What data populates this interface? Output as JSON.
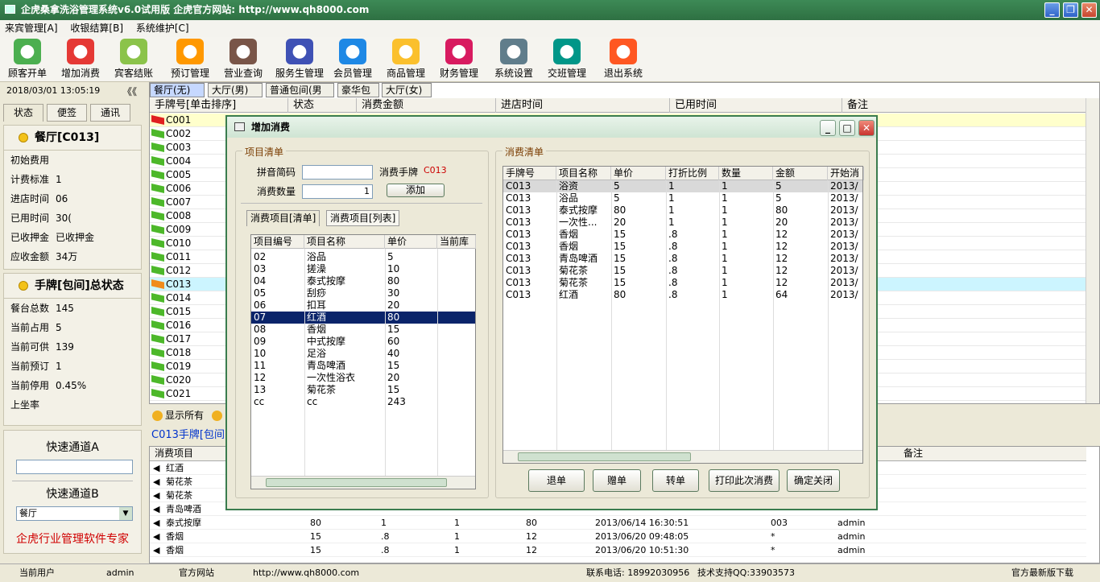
{
  "window": {
    "title": "企虎桑拿洗浴管理系统v6.0试用版    企虎官方网站: http://www.qh8000.com"
  },
  "menu": [
    "来宾管理[A]",
    "收银结算[B]",
    "系统维护[C]"
  ],
  "toolbar": [
    {
      "label": "顾客开单",
      "icon": "person-icon",
      "color": "#4caf50"
    },
    {
      "label": "增加消费",
      "icon": "add-consume-icon",
      "color": "#e53935"
    },
    {
      "label": "宾客结账",
      "icon": "checkout-arrow-icon",
      "color": "#8bc34a"
    },
    {
      "label": "预订管理",
      "icon": "alarm-clock-icon",
      "color": "#ff9800"
    },
    {
      "label": "营业查询",
      "icon": "query-icon",
      "color": "#795548"
    },
    {
      "label": "服务生管理",
      "icon": "staff-icon",
      "color": "#3f51b5"
    },
    {
      "label": "会员管理",
      "icon": "member-icon",
      "color": "#1e88e5"
    },
    {
      "label": "商品管理",
      "icon": "star-icon",
      "color": "#fbc02d"
    },
    {
      "label": "财务管理",
      "icon": "finance-icon",
      "color": "#d81b60"
    },
    {
      "label": "系统设置",
      "icon": "settings-icon",
      "color": "#607d8b"
    },
    {
      "label": "交班管理",
      "icon": "handshake-icon",
      "color": "#009688"
    },
    {
      "label": "退出系统",
      "icon": "exit-icon",
      "color": "#ff5722"
    }
  ],
  "side": {
    "datetime": "2018/03/01 13:05:19",
    "collapse": "《《",
    "tabs": [
      "状态",
      "便签",
      "通讯"
    ],
    "room_title": "餐厅[C013]",
    "room_info": [
      {
        "k": "初始费用",
        "v": ""
      },
      {
        "k": "计费标准",
        "v": "1"
      },
      {
        "k": "进店时间",
        "v": "06"
      },
      {
        "k": "已用时间",
        "v": "30("
      },
      {
        "k": "已收押金",
        "v": "已收押金"
      },
      {
        "k": "应收金额",
        "v": "34万"
      }
    ],
    "total_title": "手牌[包间]总状态",
    "total_info": [
      {
        "k": "餐台总数",
        "v": "145"
      },
      {
        "k": "当前占用",
        "v": "5"
      },
      {
        "k": "当前可供",
        "v": "139"
      },
      {
        "k": "当前预订",
        "v": "1"
      },
      {
        "k": "当前停用",
        "v": "0.45%"
      },
      {
        "k": "上坐率",
        "v": ""
      }
    ],
    "quick_a": "快速通道A",
    "quick_a_value": "",
    "quick_b": "快速通道B",
    "quick_b_value": "餐厅",
    "slogan": "企虎行业管理软件专家"
  },
  "grid": {
    "tabs": [
      "餐厅(无)",
      "大厅(男)",
      "普通包间(男",
      "豪华包间(男",
      "大厅(女)"
    ],
    "headers": [
      "手牌号[单击排序]",
      "状态",
      "消费金额",
      "进店时间",
      "已用时间",
      "备注"
    ],
    "rows": [
      "C001",
      "C002",
      "C003",
      "C004",
      "C005",
      "C006",
      "C007",
      "C008",
      "C009",
      "C010",
      "C011",
      "C012",
      "C013",
      "C014",
      "C015",
      "C016",
      "C017",
      "C018",
      "C019",
      "C020",
      "C021"
    ]
  },
  "lower": {
    "show_all": "显示所有",
    "title": "C013手牌[包间",
    "headers": [
      "消费项目",
      "备注"
    ],
    "rows": [
      {
        "name": "红酒",
        "price": "",
        "rate": "",
        "qty": "",
        "amount": "",
        "time": "",
        "waiter": "",
        "user": ""
      },
      {
        "name": "菊花茶",
        "price": "",
        "rate": "",
        "qty": "",
        "amount": "",
        "time": "",
        "waiter": "",
        "user": ""
      },
      {
        "name": "菊花茶",
        "price": "",
        "rate": "",
        "qty": "",
        "amount": "",
        "time": "",
        "waiter": "",
        "user": ""
      },
      {
        "name": "青岛啤酒",
        "price": "",
        "rate": "",
        "qty": "",
        "amount": "",
        "time": "",
        "waiter": "",
        "user": ""
      },
      {
        "name": "泰式按摩",
        "price": "80",
        "rate": "1",
        "qty": "1",
        "amount": "80",
        "time": "2013/06/14 16:30:51",
        "waiter": "003",
        "user": "admin"
      },
      {
        "name": "香烟",
        "price": "15",
        "rate": ".8",
        "qty": "1",
        "amount": "12",
        "time": "2013/06/20 09:48:05",
        "waiter": "*",
        "user": "admin"
      },
      {
        "name": "香烟",
        "price": "15",
        "rate": ".8",
        "qty": "1",
        "amount": "12",
        "time": "2013/06/20 10:51:30",
        "waiter": "*",
        "user": "admin"
      }
    ]
  },
  "status": {
    "user_label": "当前用户",
    "user": "admin",
    "site_label": "官方网站",
    "site": "http://www.qh8000.com",
    "phone": "联系电话: 18992030956",
    "qq": "技术支持QQ:33903573",
    "download": "官方最新版下载"
  },
  "dialog": {
    "title": "增加消费",
    "left_group": "项目清单",
    "pinyin_label": "拼音简码",
    "pinyin_value": "",
    "card_label": "消费手牌",
    "card_value": "C013",
    "qty_label": "消费数量",
    "qty_value": "1",
    "add_btn": "添加",
    "tabs": [
      "消费项目[清单]",
      "消费项目[列表]"
    ],
    "item_headers": [
      "项目编号",
      "项目名称",
      "单价",
      "当前库"
    ],
    "items": [
      {
        "id": "02",
        "name": "浴品",
        "price": "5"
      },
      {
        "id": "03",
        "name": "搓澡",
        "price": "10"
      },
      {
        "id": "04",
        "name": "泰式按摩",
        "price": "80"
      },
      {
        "id": "05",
        "name": "刮痧",
        "price": "30"
      },
      {
        "id": "06",
        "name": "扣耳",
        "price": "20"
      },
      {
        "id": "07",
        "name": "红酒",
        "price": "80"
      },
      {
        "id": "08",
        "name": "香烟",
        "price": "15"
      },
      {
        "id": "09",
        "name": "中式按摩",
        "price": "60"
      },
      {
        "id": "10",
        "name": "足浴",
        "price": "40"
      },
      {
        "id": "11",
        "name": "青岛啤酒",
        "price": "15"
      },
      {
        "id": "12",
        "name": "一次性浴衣",
        "price": "20"
      },
      {
        "id": "13",
        "name": "菊花茶",
        "price": "15"
      },
      {
        "id": "cc",
        "name": "cc",
        "price": "243"
      }
    ],
    "right_group": "消费清单",
    "cons_headers": [
      "手牌号",
      "项目名称",
      "单价",
      "打折比例",
      "数量",
      "金额",
      "开始消"
    ],
    "cons": [
      {
        "card": "C013",
        "name": "浴资",
        "price": "5",
        "rate": "1",
        "qty": "1",
        "amt": "5",
        "start": "2013/"
      },
      {
        "card": "C013",
        "name": "浴品",
        "price": "5",
        "rate": "1",
        "qty": "1",
        "amt": "5",
        "start": "2013/"
      },
      {
        "card": "C013",
        "name": "泰式按摩",
        "price": "80",
        "rate": "1",
        "qty": "1",
        "amt": "80",
        "start": "2013/"
      },
      {
        "card": "C013",
        "name": "一次性...",
        "price": "20",
        "rate": "1",
        "qty": "1",
        "amt": "20",
        "start": "2013/"
      },
      {
        "card": "C013",
        "name": "香烟",
        "price": "15",
        "rate": ".8",
        "qty": "1",
        "amt": "12",
        "start": "2013/"
      },
      {
        "card": "C013",
        "name": "香烟",
        "price": "15",
        "rate": ".8",
        "qty": "1",
        "amt": "12",
        "start": "2013/"
      },
      {
        "card": "C013",
        "name": "青岛啤酒",
        "price": "15",
        "rate": ".8",
        "qty": "1",
        "amt": "12",
        "start": "2013/"
      },
      {
        "card": "C013",
        "name": "菊花茶",
        "price": "15",
        "rate": ".8",
        "qty": "1",
        "amt": "12",
        "start": "2013/"
      },
      {
        "card": "C013",
        "name": "菊花茶",
        "price": "15",
        "rate": ".8",
        "qty": "1",
        "amt": "12",
        "start": "2013/"
      },
      {
        "card": "C013",
        "name": "红酒",
        "price": "80",
        "rate": ".8",
        "qty": "1",
        "amt": "64",
        "start": "2013/"
      }
    ],
    "buttons": [
      "退单",
      "赠单",
      "转单",
      "打印此次消费",
      "确定关闭"
    ]
  },
  "colors": {
    "title_green": "#2e7042",
    "selection": "#0a246a",
    "highlight_row": "#ffffcc",
    "cyan_row": "#ccf5ff",
    "slogan": "#d00000",
    "card_value": "#cc0000"
  }
}
